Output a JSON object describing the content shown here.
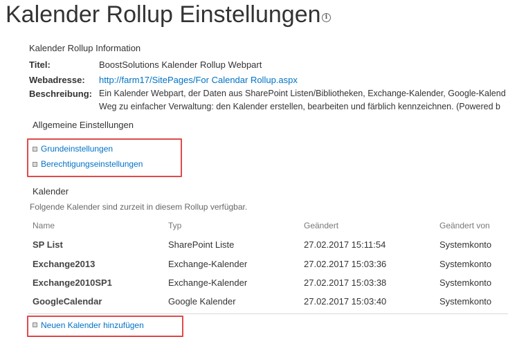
{
  "page": {
    "title": "Kalender Rollup Einstellungen",
    "info_icon": "info-icon"
  },
  "info": {
    "heading": "Kalender Rollup Information",
    "title_label": "Titel:",
    "title_value": "BoostSolutions Kalender Rollup Webpart",
    "url_label": "Webadresse:",
    "url_value": "http://farm17/SitePages/For Calendar Rollup.aspx",
    "desc_label": "Beschreibung:",
    "desc_line1": "Ein Kalender Webpart, der Daten aus SharePoint Listen/Bibliotheken, Exchange-Kalender, Google-Kalend",
    "desc_line2": "Weg zu einfacher Verwaltung: den Kalender erstellen, bearbeiten und färblich kennzeichnen. (Powered b"
  },
  "general": {
    "heading": "Allgemeine Einstellungen",
    "links": [
      "Grundeinstellungen",
      "Berechtigungseinstellungen"
    ]
  },
  "calendars": {
    "heading": "Kalender",
    "description": "Folgende Kalender sind zurzeit in diesem Rollup verfügbar.",
    "columns": [
      "Name",
      "Typ",
      "Geändert",
      "Geändert von"
    ],
    "rows": [
      {
        "name": "SP List",
        "type": "SharePoint Liste",
        "modified": "27.02.2017 15:11:54",
        "modified_by": "Systemkonto"
      },
      {
        "name": "Exchange2013",
        "type": "Exchange-Kalender",
        "modified": "27.02.2017 15:03:36",
        "modified_by": "Systemkonto"
      },
      {
        "name": "Exchange2010SP1",
        "type": "Exchange-Kalender",
        "modified": "27.02.2017 15:03:38",
        "modified_by": "Systemkonto"
      },
      {
        "name": "GoogleCalendar",
        "type": "Google Kalender",
        "modified": "27.02.2017 15:03:40",
        "modified_by": "Systemkonto"
      }
    ],
    "add_link": "Neuen Kalender hinzufügen"
  },
  "colors": {
    "link": "#0072c6",
    "highlight_box": "#e04a4a"
  }
}
